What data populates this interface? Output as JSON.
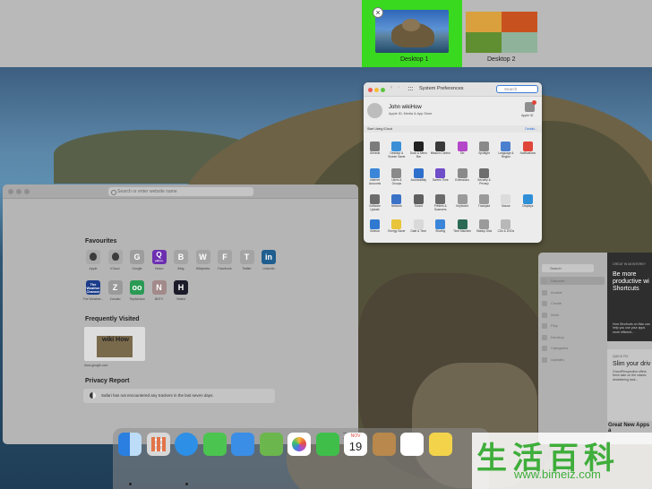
{
  "spaces": {
    "desktop1_label": "Desktop 1",
    "desktop2_label": "Desktop 2",
    "close_glyph": "×",
    "selected_color": "#39d91f"
  },
  "safari": {
    "address_placeholder": "Search or enter website name",
    "favourites_heading": "Favourites",
    "favourites": [
      {
        "label": "Apple",
        "glyph": "",
        "color": "#a9a9a9"
      },
      {
        "label": "iCloud",
        "glyph": "",
        "color": "#a9a9a9"
      },
      {
        "label": "Google",
        "glyph": "G",
        "color": "#9d9d9d"
      },
      {
        "label": "Yahoo",
        "glyph": "Q",
        "color": "#6c2fb0",
        "sub": "yahoo"
      },
      {
        "label": "Bing",
        "glyph": "B",
        "color": "#a4a4a4"
      },
      {
        "label": "Wikipedia",
        "glyph": "W",
        "color": "#a4a4a4"
      },
      {
        "label": "Facebook",
        "glyph": "F",
        "color": "#a4a4a4"
      },
      {
        "label": "Twitter",
        "glyph": "T",
        "color": "#a4a4a4"
      },
      {
        "label": "LinkedIn",
        "glyph": "in",
        "color": "#1f5e8f"
      }
    ],
    "favourites_row2": [
      {
        "label": "The Weather...",
        "glyph": "The Weather Channel",
        "color": "#1b3c8a"
      },
      {
        "label": "Zomato",
        "glyph": "Z",
        "color": "#9a9a9a"
      },
      {
        "label": "TripAdvisor",
        "glyph": "oo",
        "color": "#2a9a54"
      },
      {
        "label": "NDTV",
        "glyph": "N",
        "color": "#a38a8a"
      },
      {
        "label": "Yelahe",
        "glyph": "H",
        "color": "#1b1b2a"
      }
    ],
    "frequently_visited_heading": "Frequently Visited",
    "frequently_visited_logo": "wiki How",
    "frequently_visited_url": "docs.google.com",
    "privacy_heading": "Privacy Report",
    "privacy_text": "Safari has not encountered any trackers in the last seven days."
  },
  "system_preferences": {
    "title": "System Preferences",
    "search_placeholder": "Search",
    "user_name": "John wikiHow",
    "user_sub": "Apple ID, Media & App Store",
    "apple_id_label": "Apple ID",
    "banner_text": "Start Using iCloud",
    "banner_link": "Details...",
    "rows": [
      [
        {
          "label": "General",
          "color": "#7c7c7c"
        },
        {
          "label": "Desktop & Screen Saver",
          "color": "#3b8fd6"
        },
        {
          "label": "Dock & Menu Bar",
          "color": "#222222"
        },
        {
          "label": "Mission Control",
          "color": "#3a3a3a"
        },
        {
          "label": "Siri",
          "color": "#b446c9"
        },
        {
          "label": "Spotlight",
          "color": "#8a8a8a"
        },
        {
          "label": "Language & Region",
          "color": "#4a7fd0"
        },
        {
          "label": "Notifications",
          "color": "#e0453a"
        }
      ],
      [
        {
          "label": "Internet Accounts",
          "color": "#3b86d8"
        },
        {
          "label": "Users & Groups",
          "color": "#8a8a8a"
        },
        {
          "label": "Accessibility",
          "color": "#2f6fcc"
        },
        {
          "label": "Screen Time",
          "color": "#6f4cc8"
        },
        {
          "label": "Extensions",
          "color": "#8a8a8a"
        },
        {
          "label": "Security & Privacy",
          "color": "#6e6e6e"
        }
      ],
      [
        {
          "label": "Software Update",
          "color": "#6c6c6c"
        },
        {
          "label": "Network",
          "color": "#3a72c7"
        },
        {
          "label": "Sound",
          "color": "#5f5f5f"
        },
        {
          "label": "Printers & Scanners",
          "color": "#6b6b6b"
        },
        {
          "label": "Keyboard",
          "color": "#9a9a9a"
        },
        {
          "label": "Trackpad",
          "color": "#9a9a9a"
        },
        {
          "label": "Mouse",
          "color": "#dcdcdc"
        },
        {
          "label": "Displays",
          "color": "#2f8fd6"
        }
      ],
      [
        {
          "label": "Sidecar",
          "color": "#2f79d0"
        },
        {
          "label": "Energy Saver",
          "color": "#e8c53a"
        },
        {
          "label": "Date & Time",
          "color": "#d9d9d9"
        },
        {
          "label": "Sharing",
          "color": "#3b86d8"
        },
        {
          "label": "Time Machine",
          "color": "#2c6a55"
        },
        {
          "label": "Startup Disk",
          "color": "#9a9a9a"
        },
        {
          "label": "CDs & DVDs",
          "color": "#b8b8b8"
        }
      ]
    ]
  },
  "app_store": {
    "search_placeholder": "Search",
    "sidebar": [
      "Discover",
      "Arcade",
      "Create",
      "Work",
      "Play",
      "Develop",
      "Categories",
      "Updates"
    ],
    "card1_tag": "GREAT IN MONTEREY",
    "card1_title": "Be more productive wi Shortcuts",
    "card1_text": "How Shortcuts on Mac can help you use your apps more efficient...",
    "card2_tag": "QUICK FIX",
    "card2_title": "Slim your driv",
    "card2_text": "GrandPerspective offers fresh take on the classic decluttering task...",
    "bottom_heading": "Great New Apps a"
  },
  "dock": {
    "calendar_month": "NOV",
    "calendar_day": "19",
    "apps": [
      {
        "name": "finder",
        "color": "#3a8fe8"
      },
      {
        "name": "launchpad",
        "color": "#d8d8d8"
      },
      {
        "name": "safari",
        "color": "#2d8fe6"
      },
      {
        "name": "messages",
        "color": "#4cc450"
      },
      {
        "name": "mail",
        "color": "#3a8ee6"
      },
      {
        "name": "maps",
        "color": "#6cb64e"
      },
      {
        "name": "photos",
        "color": "#ffffff"
      },
      {
        "name": "facetime",
        "color": "#3fbf4a"
      },
      {
        "name": "calendar",
        "color": "#ffffff"
      },
      {
        "name": "contacts",
        "color": "#b8884c"
      },
      {
        "name": "reminders",
        "color": "#ffffff"
      },
      {
        "name": "notes",
        "color": "#f3d34a"
      }
    ]
  },
  "watermark": {
    "chars": "生活百科",
    "url": "www.bimeiz.com"
  }
}
